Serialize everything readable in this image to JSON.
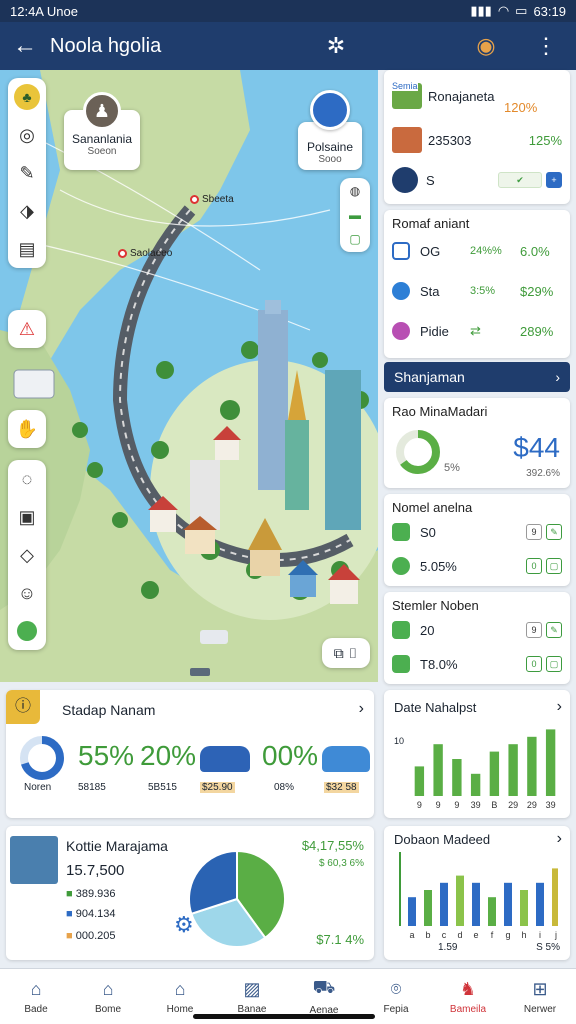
{
  "status_bar": {
    "time": "12:4A Unoe",
    "battery": "63:19"
  },
  "app_bar": {
    "title": "Noola hgolia"
  },
  "map": {
    "callout_left": {
      "title": "Sananlania",
      "sub": "Soeon"
    },
    "callout_right": {
      "title": "Polsaine",
      "sub": "Sooo"
    },
    "pin_1": "Sbeeta",
    "pin_2": "Saolaeeo"
  },
  "top_card": {
    "rows": [
      {
        "name": "Ronajaneta",
        "value": "120%",
        "badge": "Semia"
      },
      {
        "name": "235303",
        "value": "125%"
      },
      {
        "name": "S"
      }
    ]
  },
  "card2": {
    "title": "Romaf aniant",
    "rows": [
      {
        "label": "OG",
        "mid": "24%%",
        "value": "6.0%"
      },
      {
        "label": "Sta",
        "mid": "3:5%",
        "value": "$29%"
      },
      {
        "label": "Pidie",
        "mid": "",
        "value": "289%"
      }
    ]
  },
  "band": {
    "label": "Shanjaman"
  },
  "card3": {
    "title": "Rao MinaMadari",
    "donut_label": "5%",
    "big_value": "$44",
    "sub_value": "392.6%",
    "donut_fraction": 0.65
  },
  "card4": {
    "title": "Nomel anelna",
    "rows": [
      {
        "label": "S0",
        "box": "9"
      },
      {
        "label": "5.05%",
        "box": "0"
      }
    ]
  },
  "card5": {
    "title": "Stemler Noben",
    "rows": [
      {
        "label": "20",
        "box": "9"
      },
      {
        "label": "T8.0%",
        "box": "0"
      }
    ]
  },
  "bottom_left": {
    "title": "Stadap Nanam",
    "stats": [
      {
        "value": "55%",
        "sub": "58185",
        "ring_label": "Noren"
      },
      {
        "value": "20%",
        "sub": "5B515"
      },
      {
        "value": "",
        "sub": "$25.90"
      },
      {
        "value": "00%",
        "sub": "08%"
      },
      {
        "value": "",
        "sub": "$32 58"
      }
    ],
    "ring_fraction": 0.7
  },
  "bottom_right_top": {
    "title": "Date Nahalpst",
    "y_tick": "10",
    "chart_data": {
      "type": "bar",
      "categories": [
        "9",
        "9",
        "9",
        "39",
        "B",
        "29",
        "29",
        "39"
      ],
      "values": [
        4,
        7,
        5,
        3,
        6,
        7,
        8,
        9
      ],
      "ylim": [
        0,
        10
      ]
    }
  },
  "bottom_right_bottom": {
    "title": "Dobaon Madeed",
    "x_labels_left": "1.59",
    "x_labels_right": "S 5%",
    "chart_data": {
      "type": "bar",
      "categories": [
        "a",
        "b",
        "c",
        "d",
        "e",
        "f",
        "g",
        "h",
        "i",
        "j"
      ],
      "values": [
        4,
        5,
        6,
        7,
        6,
        4,
        6,
        5,
        6,
        8
      ],
      "ylim": [
        0,
        10
      ]
    }
  },
  "bottom_left2": {
    "title": "Kottie Marajama",
    "value": "15.7,500",
    "rows": [
      "389.936",
      "904.134",
      "000.205"
    ],
    "right_top": "$4,17,55%",
    "right_top_sub": "$ 60,3 6%",
    "right_bottom": "$7.1 4%",
    "pie": [
      {
        "value": 40,
        "color": "#5aae45"
      },
      {
        "value": 30,
        "color": "#9ed7ea"
      },
      {
        "value": 30,
        "color": "#2a63b3"
      }
    ]
  },
  "nav": {
    "tabs": [
      {
        "label": "Bade"
      },
      {
        "label": "Bome"
      },
      {
        "label": "Home"
      },
      {
        "label": "Banae"
      },
      {
        "label": "Aenae"
      },
      {
        "label": "Fepia"
      },
      {
        "label": "Bameila"
      },
      {
        "label": "Nerwer"
      }
    ]
  }
}
